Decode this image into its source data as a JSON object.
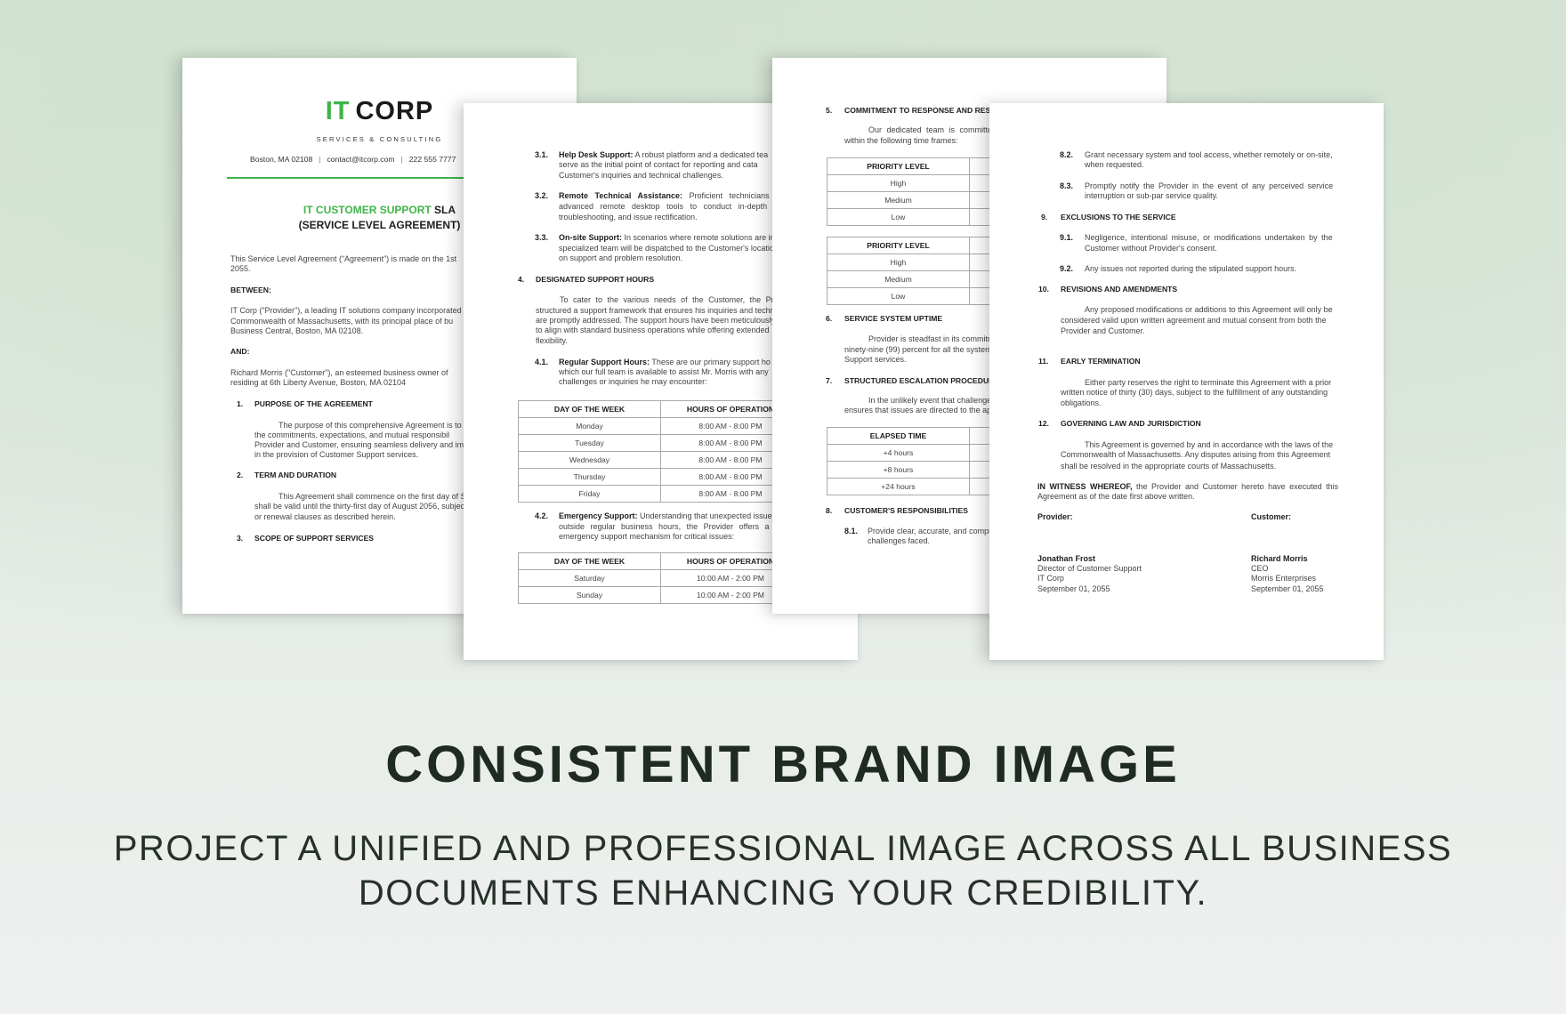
{
  "brand_color": "#3fb449",
  "page1": {
    "logo": {
      "it": "IT",
      "corp": "CORP",
      "tagline": "SERVICES & CONSULTING"
    },
    "contact": {
      "address": "Boston, MA 02108",
      "email": "contact@itcorp.com",
      "phone": "222 555 7777"
    },
    "title": {
      "green": "IT CUSTOMER SUPPORT",
      "dark": " SLA",
      "line2": "(SERVICE LEVEL AGREEMENT)"
    },
    "intro": [
      "This Service Level Agreement (“Agreement”) is made on the 1st",
      "2055."
    ],
    "between": "BETWEEN:",
    "provider": [
      "IT Corp (\"Provider\"), a leading IT solutions company incorporated ur",
      "Commonwealth of Massachusetts, with its principal place of bu",
      "Business Central, Boston, MA 02108."
    ],
    "and": "AND:",
    "customer": [
      "Richard Morris (\"Customer\"), an esteemed business owner of",
      "residing at 6th Liberty Avenue, Boston, MA 02104"
    ],
    "s1": {
      "num": "1.",
      "title": "PURPOSE OF THE AGREEMENT",
      "lines": [
        "The purpose of this comprehensive Agreement is to t",
        "the commitments, expectations, and mutual responsibil",
        "Provider and Customer, ensuring seamless delivery and imp",
        "in the provision of Customer Support services."
      ]
    },
    "s2": {
      "num": "2.",
      "title": "TERM AND DURATION",
      "lines": [
        "This Agreement shall commence on the first day of Se",
        "shall be valid until the thirty-first day of August 2056, subject",
        "or renewal clauses as described herein."
      ]
    },
    "s3": {
      "num": "3.",
      "title": "SCOPE OF SUPPORT SERVICES"
    }
  },
  "page2": {
    "s31": {
      "num": "3.1.",
      "label": "Help Desk Support:",
      "lines": [
        " A robust platform and a dedicated tea",
        "serve as the initial point of contact for reporting and cata",
        "Customer's inquiries and technical challenges."
      ]
    },
    "s32": {
      "num": "3.2.",
      "label": "Remote Technical Assistance:",
      "lines": " Proficient technicians w",
      "rest": [
        "advanced remote desktop tools to conduct in-depth d",
        "troubleshooting, and issue rectification."
      ]
    },
    "s33": {
      "num": "3.3.",
      "label": "On-site Support:",
      "lines": [
        " In scenarios where remote solutions are infe",
        "specialized team will be dispatched to the Customer's location",
        "on support and problem resolution."
      ]
    },
    "s4": {
      "num": "4.",
      "title": "DESIGNATED SUPPORT HOURS",
      "lines": [
        "To cater to the various needs of the Customer, the Pr",
        "structured a support framework that ensures his inquiries and techr",
        "are promptly addressed. The support hours have been meticulously",
        "to align with standard business operations while offering extended",
        "flexibility."
      ]
    },
    "s41": {
      "num": "4.1.",
      "label": "Regular Support Hours:",
      "lines": [
        " These are our primary support ho",
        "which our full team is available to assist Mr. Morris with any",
        "challenges or inquiries he may encounter:"
      ]
    },
    "table1": {
      "headers": [
        "DAY OF THE WEEK",
        "HOURS OF OPERATION"
      ],
      "rows": [
        [
          "Monday",
          "8:00 AM - 8:00 PM"
        ],
        [
          "Tuesday",
          "8:00 AM - 8:00 PM"
        ],
        [
          "Wednesday",
          "8:00 AM - 8:00 PM"
        ],
        [
          "Thursday",
          "8:00 AM - 8:00 PM"
        ],
        [
          "Friday",
          "8:00 AM - 8:00 PM"
        ]
      ]
    },
    "s42": {
      "num": "4.2.",
      "label": "Emergency Support:",
      "lines": [
        " Understanding that unexpected issues",
        "outside regular business hours, the Provider offers a s",
        "emergency support mechanism for critical issues:"
      ]
    },
    "table2": {
      "headers": [
        "DAY OF THE WEEK",
        "HOURS OF OPERATION"
      ],
      "rows": [
        [
          "Saturday",
          "10:00 AM - 2:00 PM"
        ],
        [
          "Sunday",
          "10:00 AM - 2:00 PM"
        ]
      ]
    }
  },
  "page3": {
    "s5": {
      "num": "5.",
      "title": "COMMITMENT TO RESPONSE AND RES",
      "lines": [
        "Our dedicated team is committed",
        "within the following time frames:"
      ]
    },
    "tableA": {
      "header": "PRIORITY LEVEL",
      "rows": [
        "High",
        "Medium",
        "Low"
      ]
    },
    "tableB": {
      "header": "PRIORITY LEVEL",
      "rows": [
        "High",
        "Medium",
        "Low"
      ]
    },
    "s6": {
      "num": "6.",
      "title": "SERVICE SYSTEM UPTIME",
      "lines": [
        "Provider is steadfast in its commitm",
        "ninety-nine (99) percent for all the system",
        "Support services."
      ]
    },
    "s7": {
      "num": "7.",
      "title": "STRUCTURED ESCALATION PROCEDUR",
      "lines": [
        "In the unlikely event that challenge",
        "ensures that issues are directed to the app"
      ]
    },
    "tableC": {
      "header": "ELAPSED TIME",
      "rows": [
        "+4 hours",
        "+8 hours",
        "+24 hours"
      ]
    },
    "s8": {
      "num": "8.",
      "title": "CUSTOMER'S RESPONSIBILITIES"
    },
    "s81": {
      "num": "8.1.",
      "lines": [
        "Provide clear, accurate, and compre",
        "challenges faced."
      ]
    }
  },
  "page4": {
    "s82": {
      "num": "8.2.",
      "lines": [
        "Grant necessary system and tool access, whether remotely or on-site,",
        "when requested."
      ]
    },
    "s83": {
      "num": "8.3.",
      "lines": [
        "Promptly notify the Provider in the event of any perceived service",
        "interruption or sub-par service quality."
      ]
    },
    "s9": {
      "num": "9.",
      "title": "EXCLUSIONS TO THE SERVICE"
    },
    "s91": {
      "num": "9.1.",
      "lines": [
        "Negligence, intentional misuse, or modifications undertaken by the",
        "Customer without Provider's consent."
      ]
    },
    "s92": {
      "num": "9.2.",
      "lines": [
        "Any issues not reported during the stipulated support hours."
      ]
    },
    "s10": {
      "num": "10.",
      "title": "REVISIONS AND AMENDMENTS",
      "lines": [
        "Any proposed modifications or additions to this Agreement will only be",
        "considered valid upon written agreement and mutual consent from both the",
        "Provider and Customer."
      ]
    },
    "s11": {
      "num": "11.",
      "title": "EARLY TERMINATION",
      "lines": [
        "Either party reserves the right to terminate this Agreement with a prior",
        "written notice of thirty (30) days, subject to the fulfillment of any outstanding",
        "obligations."
      ]
    },
    "s12": {
      "num": "12.",
      "title": "GOVERNING LAW AND JURISDICTION",
      "lines": [
        "This Agreement is governed by and in accordance with the laws of the",
        "Commonwealth of Massachusetts. Any disputes arising from this Agreement",
        "shall be resolved in the appropriate courts of Massachusetts."
      ]
    },
    "witness": {
      "bold": "IN WITNESS WHEREOF,",
      "lines": [
        " the Provider and Customer hereto have executed this",
        "Agreement as of the date first above written."
      ]
    },
    "provider": {
      "label": "Provider:",
      "name": "Jonathan Frost",
      "title": "Director of Customer Support",
      "company": "IT Corp",
      "date": "September 01, 2055"
    },
    "customer": {
      "label": "Customer:",
      "name": "Richard Morris",
      "title": "CEO",
      "company": "Morris Enterprises",
      "date": "September 01, 2055"
    }
  },
  "headline": "CONSISTENT BRAND IMAGE",
  "subheadline": [
    "PROJECT A UNIFIED AND PROFESSIONAL IMAGE ACROSS ALL BUSINESS",
    "DOCUMENTS ENHANCING YOUR CREDIBILITY."
  ]
}
